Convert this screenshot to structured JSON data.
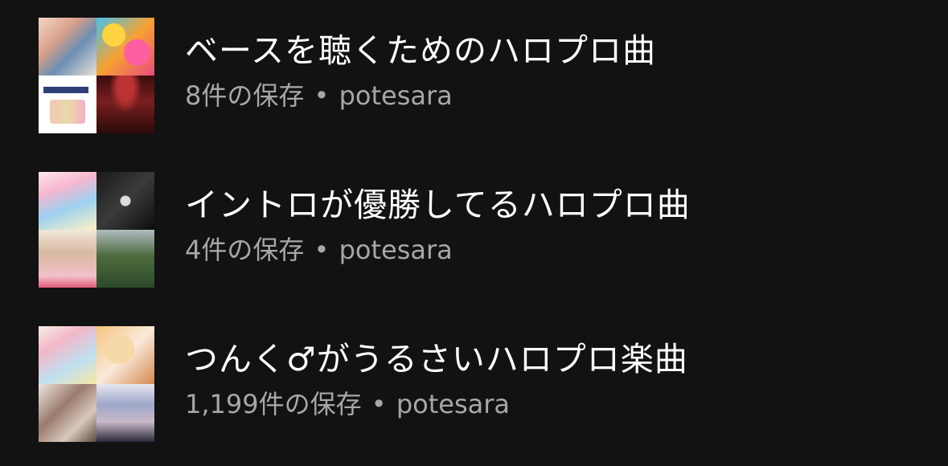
{
  "playlists": [
    {
      "title": "ベースを聴くためのハロプロ曲",
      "saves": "8件の保存",
      "separator": "•",
      "owner": "potesara"
    },
    {
      "title": "イントロが優勝してるハロプロ曲",
      "saves": "4件の保存",
      "separator": "•",
      "owner": "potesara"
    },
    {
      "title": "つんく♂がうるさいハロプロ楽曲",
      "saves": "1,199件の保存",
      "separator": "•",
      "owner": "potesara"
    }
  ],
  "colors": {
    "background": "#121212",
    "title_text": "#ffffff",
    "meta_text": "#a7a7a7"
  }
}
